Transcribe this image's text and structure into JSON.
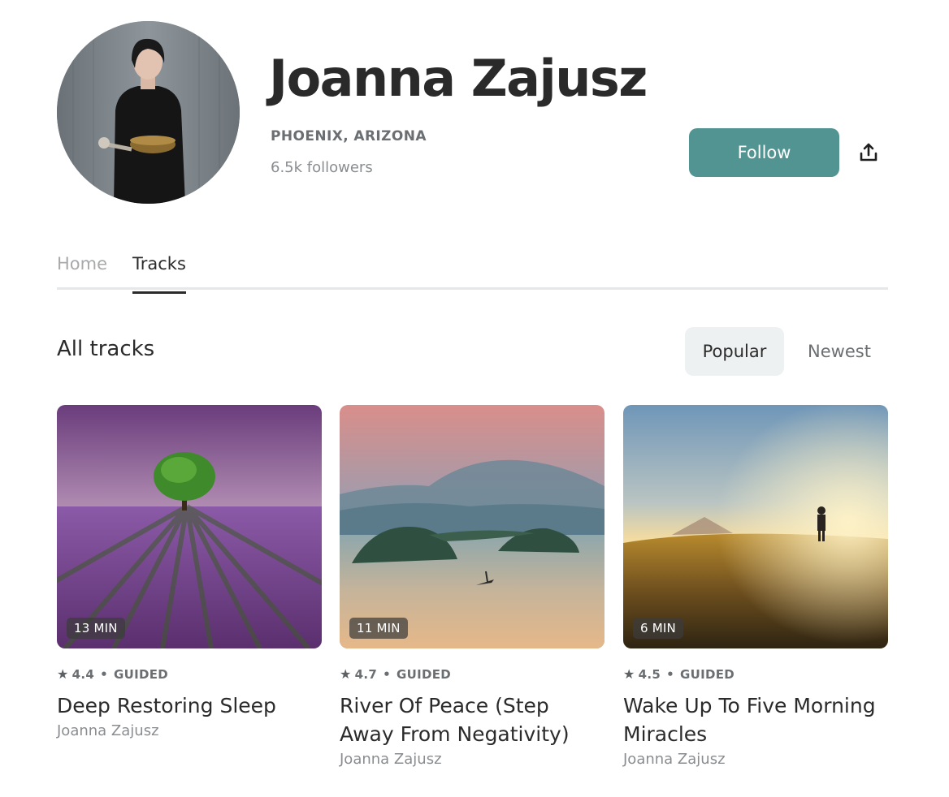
{
  "profile": {
    "name": "Joanna Zajusz",
    "location": "PHOENIX, ARIZONA",
    "followers": "6.5k followers",
    "follow_label": "Follow",
    "share_icon": "share-icon"
  },
  "tabs": [
    {
      "label": "Home",
      "active": false
    },
    {
      "label": "Tracks",
      "active": true
    }
  ],
  "section": {
    "title": "All tracks",
    "sort_options": [
      {
        "label": "Popular",
        "selected": true
      },
      {
        "label": "Newest",
        "selected": false
      }
    ]
  },
  "tracks": [
    {
      "duration": "13 MIN",
      "rating": "4.4",
      "type": "GUIDED",
      "title": "Deep Restoring Sleep",
      "author": "Joanna Zajusz"
    },
    {
      "duration": "11 MIN",
      "rating": "4.7",
      "type": "GUIDED",
      "title": "River Of Peace (Step Away From Negativity)",
      "author": "Joanna Zajusz"
    },
    {
      "duration": "6 MIN",
      "rating": "4.5",
      "type": "GUIDED",
      "title": "Wake Up To Five Morning Miracles",
      "author": "Joanna Zajusz"
    }
  ],
  "colors": {
    "accent": "#529491",
    "text": "#2b2b2b",
    "muted": "#8a8d90"
  }
}
